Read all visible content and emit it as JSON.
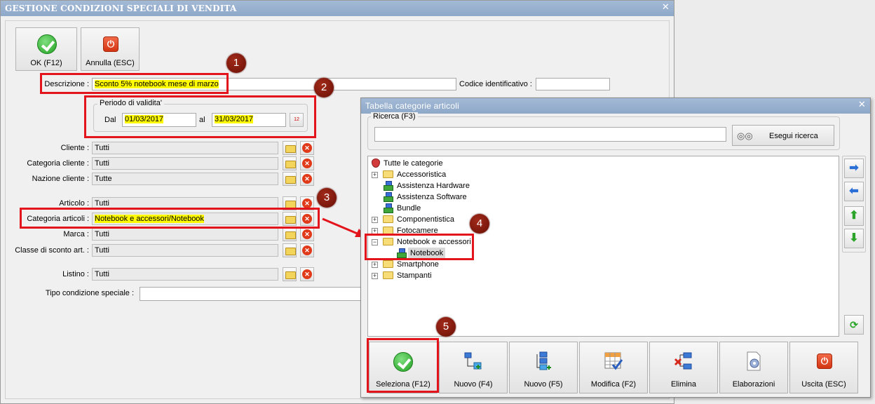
{
  "main_window": {
    "title": "GESTIONE CONDIZIONI SPECIALI DI VENDITA",
    "close_glyph": "✕",
    "ok_button": "OK (F12)",
    "cancel_button": "Annulla (ESC)",
    "fields": {
      "descrizione": {
        "label": "Descrizione :",
        "value": "Sconto 5% notebook mese di marzo"
      },
      "codice": {
        "label": "Codice identificativo :",
        "value": ""
      },
      "periodo": {
        "title": "Periodo di validita'",
        "dal_label": "Dal",
        "dal": "01/03/2017",
        "al_label": "al",
        "al": "31/03/2017",
        "cal_text": "12"
      },
      "cliente": {
        "label": "Cliente :",
        "value": "Tutti"
      },
      "categoria_cliente": {
        "label": "Categoria cliente :",
        "value": "Tutti"
      },
      "nazione_cliente": {
        "label": "Nazione cliente :",
        "value": "Tutte"
      },
      "articolo": {
        "label": "Articolo :",
        "value": "Tutti"
      },
      "categoria_articoli": {
        "label": "Categoria articoli :",
        "value": "Notebook e accessori/Notebook"
      },
      "marca": {
        "label": "Marca :",
        "value": "Tutti"
      },
      "classe_sconto": {
        "label": "Classe di sconto art. :",
        "value": "Tutti"
      },
      "listino": {
        "label": "Listino :",
        "value": "Tutti"
      },
      "tipo_condizione": {
        "label": "Tipo condizione speciale :",
        "value": ""
      }
    }
  },
  "markers": [
    "1",
    "2",
    "3",
    "4",
    "5"
  ],
  "dialog": {
    "title": "Tabella categorie articoli",
    "close_glyph": "✕",
    "search_group_title": "Ricerca (F3)",
    "search_value": "",
    "search_button": "Esegui ricerca",
    "tree": [
      {
        "label": "Tutte le categorie",
        "icon": "strawberry-icon",
        "level": 0,
        "expander": ""
      },
      {
        "label": "Accessoristica",
        "icon": "folder-icon",
        "level": 1,
        "expander": "+"
      },
      {
        "label": "Assistenza Hardware",
        "icon": "category-icon",
        "level": 1,
        "expander": ""
      },
      {
        "label": "Assistenza Software",
        "icon": "category-icon",
        "level": 1,
        "expander": ""
      },
      {
        "label": "Bundle",
        "icon": "category-icon",
        "level": 1,
        "expander": ""
      },
      {
        "label": "Componentistica",
        "icon": "folder-icon",
        "level": 1,
        "expander": "+"
      },
      {
        "label": "Fotocamere",
        "icon": "folder-icon",
        "level": 1,
        "expander": "+"
      },
      {
        "label": "Notebook e accessori",
        "icon": "folder-icon",
        "level": 1,
        "expander": "−"
      },
      {
        "label": "Notebook",
        "icon": "category-icon",
        "level": 2,
        "expander": "",
        "selected": true
      },
      {
        "label": "Smartphone",
        "icon": "folder-icon",
        "level": 1,
        "expander": "+"
      },
      {
        "label": "Stampanti",
        "icon": "folder-icon",
        "level": 1,
        "expander": "+"
      }
    ],
    "side_buttons": [
      {
        "name": "arrow-right-icon",
        "glyph": "➡"
      },
      {
        "name": "arrow-left-icon",
        "glyph": "⬅"
      },
      {
        "name": "arrow-up-icon",
        "glyph": "⬆"
      },
      {
        "name": "arrow-down-icon",
        "glyph": "⬇"
      }
    ],
    "footer_buttons": [
      {
        "label": "Seleziona (F12)",
        "icon": "check-icon"
      },
      {
        "label": "Nuovo (F4)",
        "icon": "new-node-icon"
      },
      {
        "label": "Nuovo (F5)",
        "icon": "new-child-node-icon"
      },
      {
        "label": "Modifica (F2)",
        "icon": "edit-grid-icon"
      },
      {
        "label": "Elimina",
        "icon": "delete-node-icon"
      },
      {
        "label": "Elaborazioni",
        "icon": "gear-document-icon"
      },
      {
        "label": "Uscita (ESC)",
        "icon": "exit-icon"
      }
    ]
  },
  "colors": {
    "highlight": "#fffa00",
    "annotation_red": "#e3141b",
    "marker": "#7a1508",
    "titlebar": "#9ab2d0"
  }
}
